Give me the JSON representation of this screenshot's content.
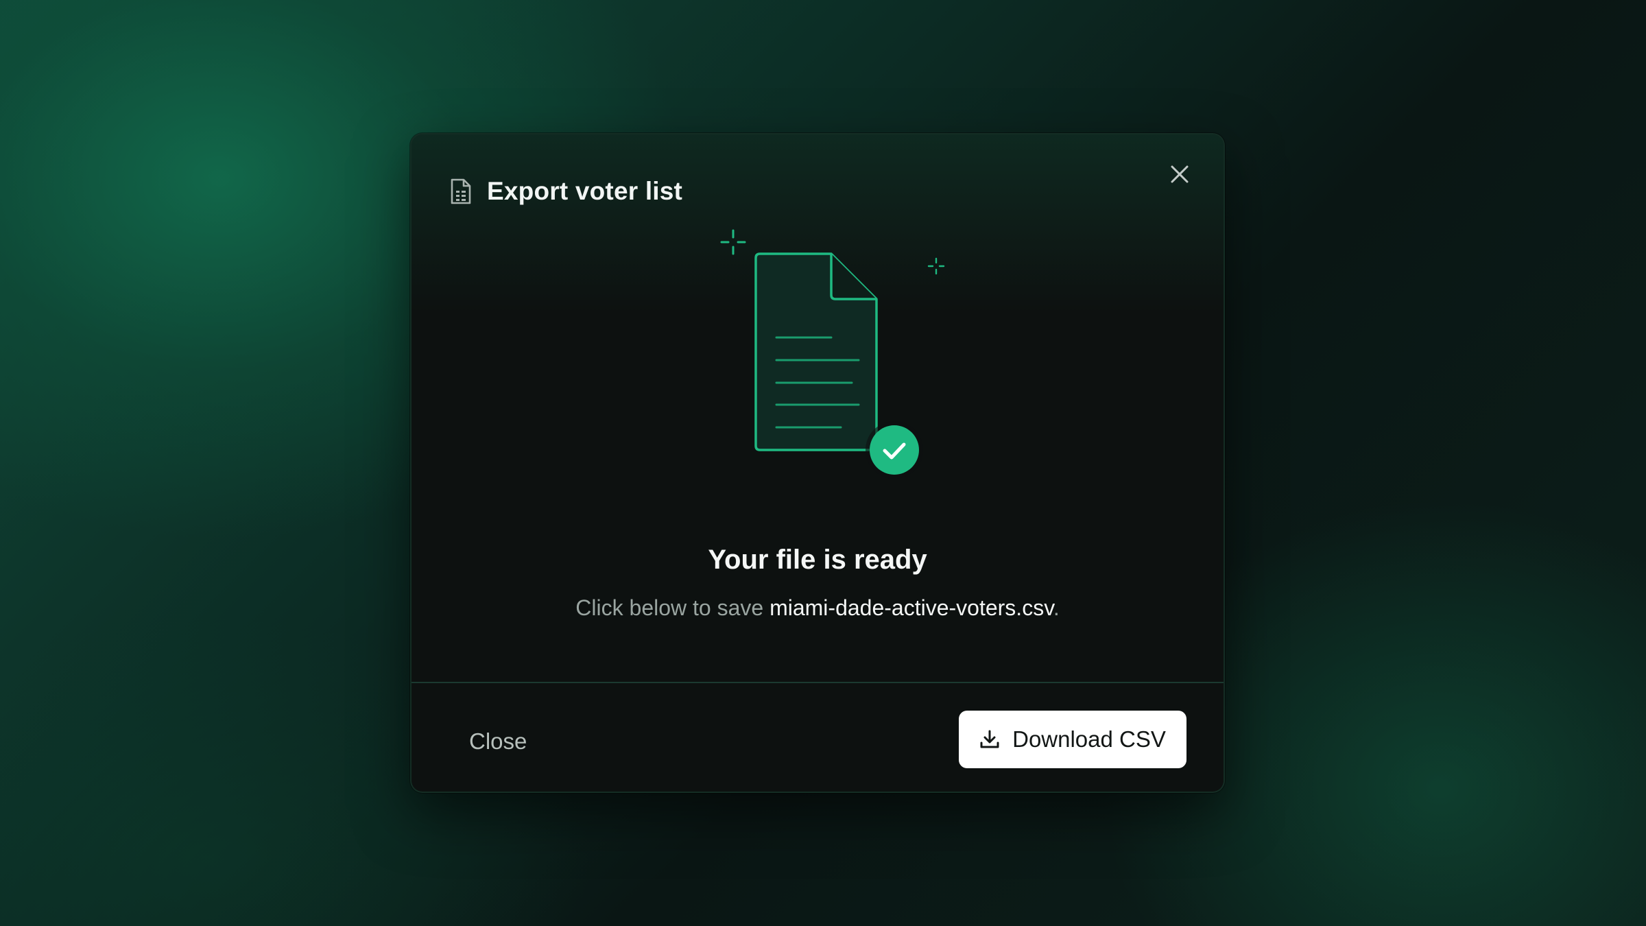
{
  "modal": {
    "title": "Export voter list",
    "title_icon": "spreadsheet-file-icon",
    "close_icon": "close-icon",
    "headline": "Your file is ready",
    "subtext_prefix": "Click below to save ",
    "filename": "miami-dade-active-voters.csv",
    "subtext_suffix": "."
  },
  "illustration": {
    "icon": "document-check-icon",
    "sparkle_icon": "sparkle-icon"
  },
  "footer": {
    "close_label": "Close",
    "download_label": "Download CSV",
    "download_icon": "download-icon"
  },
  "colors": {
    "accent": "#1fba82",
    "accent_bright": "#2ad894",
    "modal_bg": "#0d1110",
    "button_bg": "#ffffff"
  }
}
